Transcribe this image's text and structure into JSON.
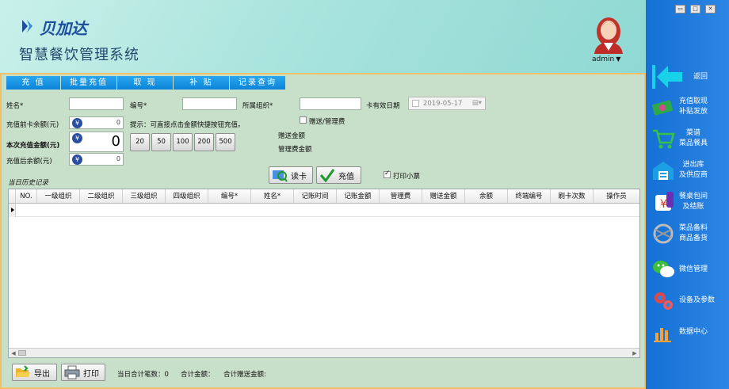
{
  "header": {
    "brand": "贝加达",
    "app_title": "智慧餐饮管理系统",
    "user": "admin",
    "user_caret": "▼"
  },
  "tabs": [
    "充 值",
    "批量充值",
    "取 现",
    "补 贴",
    "记录查询"
  ],
  "form": {
    "name_label": "姓名*",
    "no_label": "编号*",
    "org_label": "所属组织*",
    "expiry_label": "卡有效日期",
    "expiry_value": "2019-05-17",
    "gift_fee_label": "赠送/管理费",
    "before_balance_label": "充值前卡余额(元)",
    "before_balance_value": "0",
    "amount_label": "本次充值金额(元)",
    "amount_value": "0",
    "after_balance_label": "充值后余额(元)",
    "after_balance_value": "0",
    "hint": "提示：可直接点击金额快捷按钮充值。",
    "quick_amounts": [
      "20",
      "50",
      "100",
      "200",
      "500"
    ],
    "gift_amount_label": "赠送金额",
    "fee_amount_label": "管理费金额",
    "read_card": "读卡",
    "recharge": "充值",
    "print_receipt_label": "打印小票",
    "print_receipt_checked": true,
    "yen": "¥"
  },
  "history": {
    "title": "当日历史记录",
    "columns": [
      "NO.",
      "一级组织",
      "二级组织",
      "三级组织",
      "四级组织",
      "编号*",
      "姓名*",
      "记账时间",
      "记账金额",
      "管理费",
      "赠送金额",
      "余额",
      "终端编号",
      "刷卡次数",
      "操作员"
    ]
  },
  "footer": {
    "export": "导出",
    "print": "打印",
    "total_count_label": "当日合计笔数：",
    "total_count_value": "0",
    "total_amount_label": "合计金额：",
    "total_gift_label": "合计赠送金额:"
  },
  "sidebar": {
    "window_controls": [
      "▭",
      "□",
      "✕"
    ],
    "items": [
      {
        "label": "返回",
        "icon": "back-arrow-icon"
      },
      {
        "label": "充值取现\n补贴发放",
        "icon": "cash-icon"
      },
      {
        "label": "菜谱\n菜品餐具",
        "icon": "cart-icon"
      },
      {
        "label": "进出库\n及供应商",
        "icon": "warehouse-icon"
      },
      {
        "label": "餐桌包间\n及结账",
        "icon": "dining-table-icon"
      },
      {
        "label": "菜品备料\n商品备货",
        "icon": "globe-icon"
      },
      {
        "label": "微信管理",
        "icon": "wechat-icon"
      },
      {
        "label": "设备及参数",
        "icon": "gears-icon"
      },
      {
        "label": "数据中心",
        "icon": "bar-chart-icon"
      }
    ]
  },
  "colors": {
    "tab_blue": "#0b84d9",
    "sidebar_blue": "#1570d5",
    "panel_green": "#c8dfc9",
    "panel_border": "#f0c06a"
  }
}
